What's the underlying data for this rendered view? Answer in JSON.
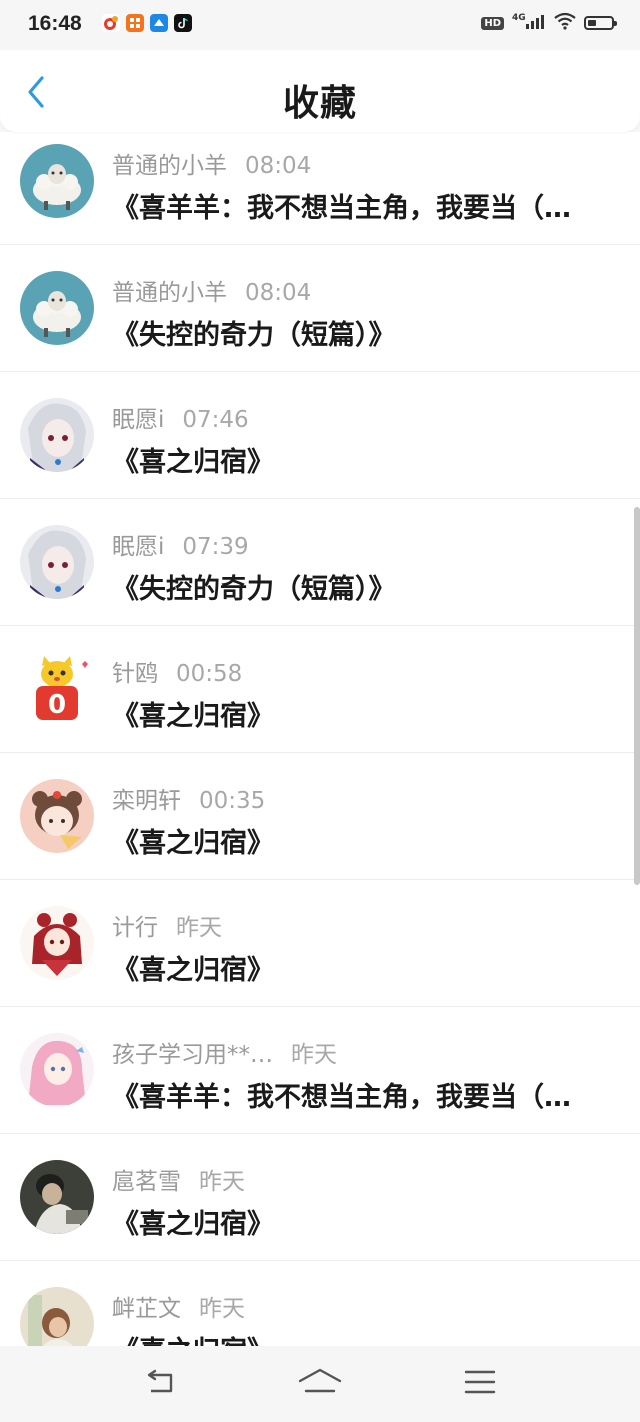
{
  "status_bar": {
    "time": "16:48",
    "network": "4G",
    "hd_badge": "HD",
    "battery_level": 0.35
  },
  "header": {
    "title": "收藏",
    "back_icon": "chevron-left-icon"
  },
  "favorites": [
    {
      "user": "普通的小羊",
      "time": "08:04",
      "title": "《喜羊羊：我不想当主角，我要当（…",
      "avatar": "sheep"
    },
    {
      "user": "普通的小羊",
      "time": "08:04",
      "title": "《失控的奇力（短篇）》",
      "avatar": "sheep"
    },
    {
      "user": "眠愿i",
      "time": "07:46",
      "title": "《喜之归宿》",
      "avatar": "anime-silver"
    },
    {
      "user": "眠愿i",
      "time": "07:39",
      "title": "《失控的奇力（短篇）》",
      "avatar": "anime-silver"
    },
    {
      "user": "针鸥",
      "time": "00:58",
      "title": "《喜之归宿》",
      "avatar": "cat-zero"
    },
    {
      "user": "栾明轩",
      "time": "00:35",
      "title": "《喜之归宿》",
      "avatar": "bear-girl"
    },
    {
      "user": "计行",
      "time": "昨天",
      "title": "《喜之归宿》",
      "avatar": "red-girl"
    },
    {
      "user": "孩子学习用**…",
      "time": "昨天",
      "title": "《喜羊羊：我不想当主角，我要当（…",
      "avatar": "pink-girl"
    },
    {
      "user": "扈茗雪",
      "time": "昨天",
      "title": "《喜之归宿》",
      "avatar": "photo-dark"
    },
    {
      "user": "衅芷文",
      "time": "昨天",
      "title": "《喜之归宿》",
      "avatar": "photo-light"
    }
  ],
  "nav": {
    "back": "back-icon",
    "home": "home-icon",
    "menu": "menu-icon"
  },
  "colors": {
    "accent": "#2f9ae0",
    "background": "#f6f6f6",
    "meta_text": "#9a9a9a"
  }
}
